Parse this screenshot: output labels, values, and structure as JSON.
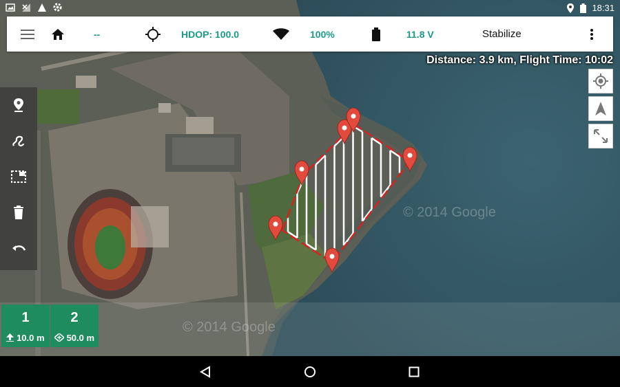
{
  "status_bar": {
    "time": "18:31",
    "left_icons": [
      "image-icon",
      "no-signal-icon",
      "navigation-icon",
      "settings-icon"
    ],
    "right_icons": [
      "location-icon",
      "battery-icon"
    ]
  },
  "top_bar": {
    "altitude": "--",
    "hdop": "HDOP: 100.0",
    "signal": "100%",
    "voltage": "11.8 V",
    "mode": "Stabilize",
    "accent_color": "#1a9a86"
  },
  "banner": "Distance: 3.9 km, Flight Time: 10:02",
  "map": {
    "watermarks": [
      "© 2014 Google",
      "© 2014 Google"
    ],
    "polygon_color": "#d62222",
    "marker_color": "#e14a3c"
  },
  "left_toolbar": {
    "items": [
      "marker-tool",
      "spline-tool",
      "survey-area-tool",
      "delete-tool",
      "undo-tool"
    ]
  },
  "right_controls": [
    "my-location",
    "navigation-arrow",
    "fullscreen"
  ],
  "waypoints": [
    {
      "number": "1",
      "value": "10.0 m",
      "type": "altitude"
    },
    {
      "number": "2",
      "value": "50.0 m",
      "type": "survey"
    }
  ],
  "nav_bar": [
    "back",
    "home",
    "recents"
  ]
}
